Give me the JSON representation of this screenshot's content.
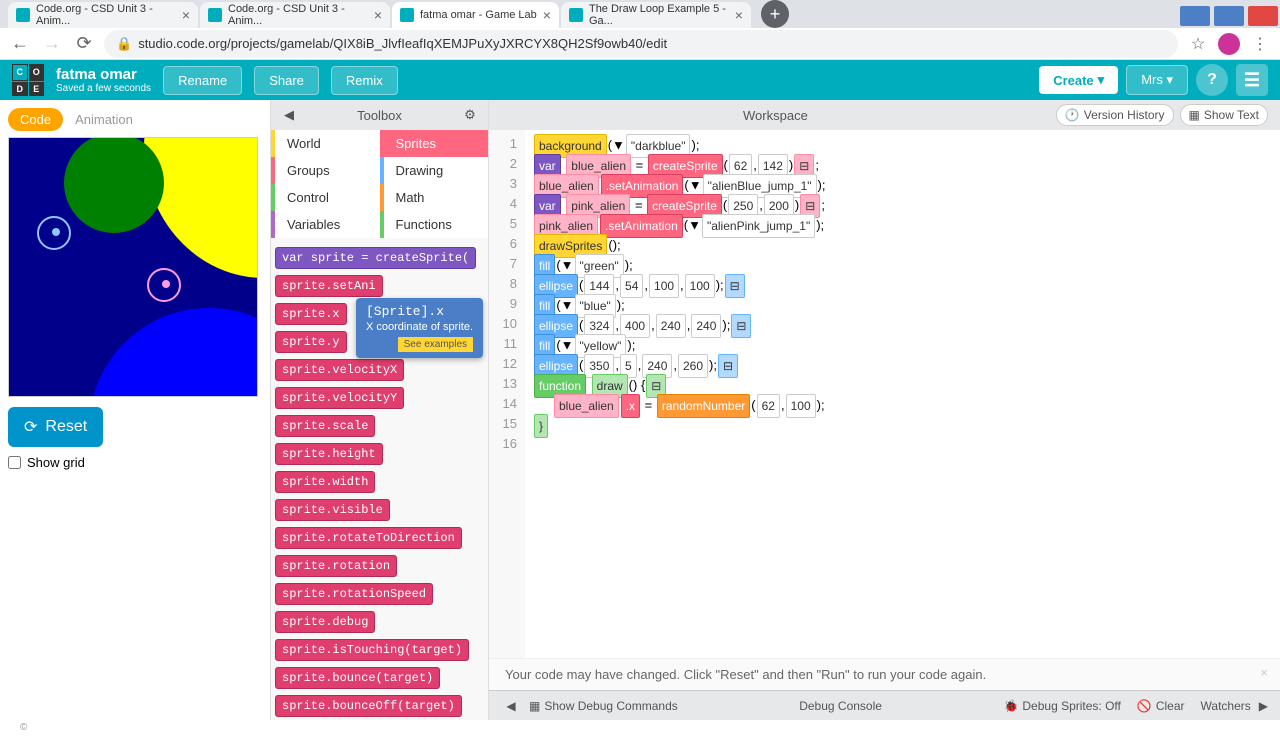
{
  "browser": {
    "tabs": [
      {
        "title": "Code.org - CSD Unit 3 - Anim..."
      },
      {
        "title": "Code.org - CSD Unit 3 - Anim..."
      },
      {
        "title": "fatma omar - Game Lab"
      },
      {
        "title": "The Draw Loop Example 5 - Ga..."
      }
    ],
    "url": "studio.code.org/projects/gamelab/QIX8iB_JlvfIeafIqXEMJPuXyJXRCYX8QH2Sf9owb40/edit"
  },
  "header": {
    "project_name": "fatma omar",
    "save_status": "Saved a few seconds",
    "rename": "Rename",
    "share": "Share",
    "remix": "Remix",
    "create": "Create",
    "user": "Mrs"
  },
  "modes": {
    "code": "Code",
    "animation": "Animation"
  },
  "reset": "Reset",
  "show_grid": "Show grid",
  "toolbox": {
    "title": "Toolbox",
    "categories": {
      "world": "World",
      "sprites": "Sprites",
      "groups": "Groups",
      "drawing": "Drawing",
      "control": "Control",
      "math": "Math",
      "variables": "Variables",
      "functions": "Functions"
    },
    "blocks": [
      "var sprite = createSprite(",
      "sprite.setAni",
      "sprite.x",
      "sprite.y",
      "sprite.velocityX",
      "sprite.velocityY",
      "sprite.scale",
      "sprite.height",
      "sprite.width",
      "sprite.visible",
      "sprite.rotateToDirection",
      "sprite.rotation",
      "sprite.rotationSpeed",
      "sprite.debug",
      "sprite.isTouching(target)",
      "sprite.bounce(target)",
      "sprite.bounceOff(target)"
    ],
    "tooltip": {
      "title": "[Sprite].x",
      "desc": "X coordinate of sprite.",
      "link": "See examples"
    }
  },
  "workspace": {
    "title": "Workspace",
    "version_history": "Version History",
    "show_text": "Show Text",
    "lines": [
      "1",
      "2",
      "3",
      "4",
      "5",
      "6",
      "7",
      "8",
      "9",
      "10",
      "11",
      "12",
      "13",
      "14",
      "15",
      "16"
    ],
    "code": {
      "l1_bg": "background",
      "l1_val": "\"darkblue\"",
      "l2_var": "var",
      "l2_name": "blue_alien",
      "l2_cs": "createSprite",
      "l2_a": "62",
      "l2_b": "142",
      "l3_obj": "blue_alien",
      "l3_m": ".setAnimation",
      "l3_v": "\"alienBlue_jump_1\"",
      "l4_var": "var",
      "l4_name": "pink_alien",
      "l4_cs": "createSprite",
      "l4_a": "250",
      "l4_b": "200",
      "l5_obj": "pink_alien",
      "l5_m": ".setAnimation",
      "l5_v": "\"alienPink_jump_1\"",
      "l6": "drawSprites",
      "l7_f": "fill",
      "l7_v": "\"green\"",
      "l8_e": "ellipse",
      "l8_a": "144",
      "l8_b": "54",
      "l8_c": "100",
      "l8_d": "100",
      "l9_f": "fill",
      "l9_v": "\"blue\"",
      "l10_e": "ellipse",
      "l10_a": "324",
      "l10_b": "400",
      "l10_c": "240",
      "l10_d": "240",
      "l11_f": "fill",
      "l11_v": "\"yellow\"",
      "l12_e": "ellipse",
      "l12_a": "350",
      "l12_b": "5",
      "l12_c": "240",
      "l12_d": "260",
      "l13_fn": "function",
      "l13_name": "draw",
      "l14_obj": "blue_alien",
      "l14_prop": ".x",
      "l14_rn": "randomNumber",
      "l14_a": "62",
      "l14_b": "100"
    },
    "status": "Your code may have changed. Click \"Reset\" and then \"Run\" to run your code again."
  },
  "debug": {
    "show_cmds": "Show Debug Commands",
    "console": "Debug Console",
    "sprites": "Debug Sprites: Off",
    "clear": "Clear",
    "watchers": "Watchers"
  },
  "footer": "©"
}
